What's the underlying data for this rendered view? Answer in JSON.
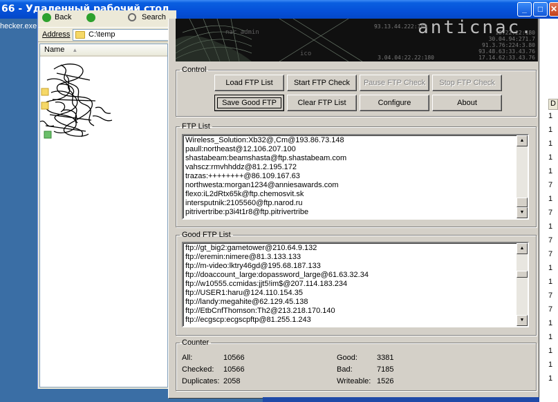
{
  "window": {
    "title": "66 - Удаленный рабочий стол",
    "minimize": "_",
    "maximize": "□",
    "close": "✕"
  },
  "desktop": {
    "left_text": "hecker.exe"
  },
  "explorer": {
    "toolbar_back": "Back",
    "toolbar_search": "Search",
    "address_label": "Address",
    "address_value": "C:\\temp",
    "column_name": "Name"
  },
  "right_strip": {
    "header": "D",
    "cells": [
      "1",
      "1",
      "1",
      "1",
      "1",
      "7",
      "1",
      "7",
      "1",
      "7",
      "7",
      "1",
      "1",
      "7",
      "7",
      "1",
      "1",
      "1",
      "1",
      "1"
    ]
  },
  "banner": {
    "title": "anticnac.",
    "overlay_text": "nac admin",
    "overlay_text2": "ico",
    "numbers": [
      "18:22:22:180",
      "30.04.94:271.7",
      "91.3.76:224:3.80",
      "93.48.63:33.43.76",
      "17.14.62:33.43.76",
      "93.13.44.222:180",
      "3.04.04:22.22:180"
    ]
  },
  "control": {
    "legend": "Control",
    "buttons": {
      "load": "Load FTP List",
      "start": "Start FTP Check",
      "pause": "Pause FTP Check",
      "stop": "Stop FTP Check",
      "save": "Save Good FTP",
      "clear": "Clear FTP List",
      "configure": "Configure",
      "about": "About"
    }
  },
  "ftp_list": {
    "legend": "FTP List",
    "items": [
      "Wireless_Solution:Xb32@,Cm@193.86.73.148",
      "paull:northeast@12.106.207.100",
      "shastabeam:beamshasta@ftp.shastabeam.com",
      "vahscz:rmvhhddz@81.2.195.172",
      "trazas:++++++++@86.109.167.63",
      "northwesta:morgan1234@anniesawards.com",
      "flexo:iL2dRtx65k@ftp.chemosvit.sk",
      "intersputnik:2105560@ftp.narod.ru",
      "pitrivertribe:p3i4t1r8@ftp.pitrivertribe"
    ]
  },
  "good_list": {
    "legend": "Good FTP List",
    "items": [
      "ftp://gt_big2:gametower@210.64.9.132",
      "ftp://eremin:nimere@81.3.133.133",
      "ftp://m-video:lktry46gd@195.68.187.133",
      "ftp://doaccount_large:dopassword_large@61.63.32.34",
      "ftp://w10555.ccmidas:jjt5!im$@207.114.183.234",
      "ftp://USER1:haru@124.110.154.35",
      "ftp://landy:megahite@62.129.45.138",
      "ftp://EtbCnfThomson:Th2@213.218.170.140",
      "ftp://ecgscp:ecgscpftp@81.255.1.243"
    ]
  },
  "counter": {
    "legend": "Counter",
    "all_label": "All:",
    "all_value": "10566",
    "checked_label": "Checked:",
    "checked_value": "10566",
    "duplicates_label": "Duplicates:",
    "duplicates_value": "2058",
    "good_label": "Good:",
    "good_value": "3381",
    "bad_label": "Bad:",
    "bad_value": "7185",
    "writeable_label": "Writeable:",
    "writeable_value": "1526"
  }
}
